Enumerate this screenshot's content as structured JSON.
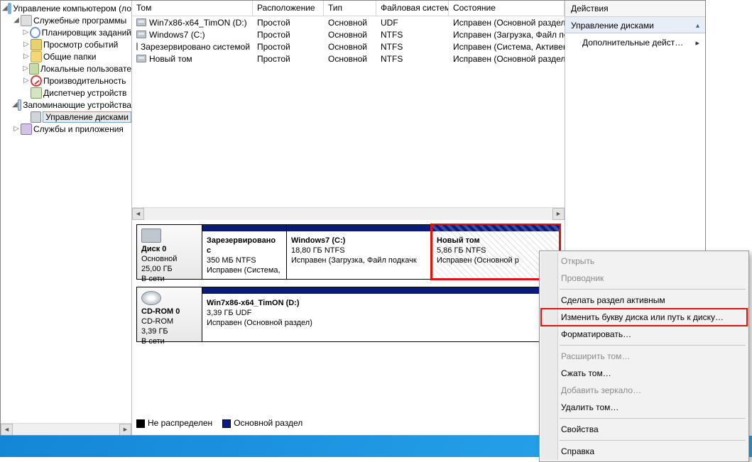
{
  "tree": {
    "root": "Управление компьютером (ло",
    "group1": "Служебные программы",
    "g1_items": [
      "Планировщик заданий",
      "Просмотр событий",
      "Общие папки",
      "Локальные пользовате",
      "Производительность",
      "Диспетчер устройств"
    ],
    "group2": "Запоминающие устройства",
    "g2_item": "Управление дисками",
    "group3": "Службы и приложения"
  },
  "columns": [
    "Том",
    "Расположение",
    "Тип",
    "Файловая система",
    "Состояние"
  ],
  "rows": [
    {
      "name": "Win7x86-x64_TimON (D:)",
      "layout": "Простой",
      "type": "Основной",
      "fs": "UDF",
      "state": "Исправен (Основной раздел"
    },
    {
      "name": "Windows7 (C:)",
      "layout": "Простой",
      "type": "Основной",
      "fs": "NTFS",
      "state": "Исправен (Загрузка, Файл по"
    },
    {
      "name": "Зарезервировано системой",
      "layout": "Простой",
      "type": "Основной",
      "fs": "NTFS",
      "state": "Исправен (Система, Активен"
    },
    {
      "name": "Новый том",
      "layout": "Простой",
      "type": "Основной",
      "fs": "NTFS",
      "state": "Исправен (Основной раздел"
    }
  ],
  "disk0": {
    "title": "Диск 0",
    "type": "Основной",
    "size": "25,00 ГБ",
    "status": "В сети",
    "parts": [
      {
        "name": "Зарезервировано с",
        "size": "350 МБ NTFS",
        "state": "Исправен (Система,"
      },
      {
        "name": "Windows7  (C:)",
        "size": "18,80 ГБ NTFS",
        "state": "Исправен (Загрузка, Файл подкачк"
      },
      {
        "name": "Новый том",
        "size": "5,86 ГБ NTFS",
        "state": "Исправен (Основной р"
      }
    ]
  },
  "cdrom": {
    "title": "CD-ROM 0",
    "type": "CD-ROM",
    "size": "3,39 ГБ",
    "status": "В сети",
    "part": {
      "name": "Win7x86-x64_TimON (D:)",
      "size": "3,39 ГБ UDF",
      "state": "Исправен (Основной раздел)"
    }
  },
  "legend": {
    "unalloc": "Не распределен",
    "primary": "Основной раздел"
  },
  "actions": {
    "title": "Действия",
    "section": "Управление дисками",
    "more": "Дополнительные дейст…"
  },
  "context_menu": {
    "open": "Открыть",
    "explorer": "Проводник",
    "make_active": "Сделать раздел активным",
    "change_letter": "Изменить букву диска или путь к диску…",
    "format": "Форматировать…",
    "extend": "Расширить том…",
    "shrink": "Сжать том…",
    "mirror": "Добавить зеркало…",
    "delete": "Удалить том…",
    "properties": "Свойства",
    "help": "Справка"
  }
}
